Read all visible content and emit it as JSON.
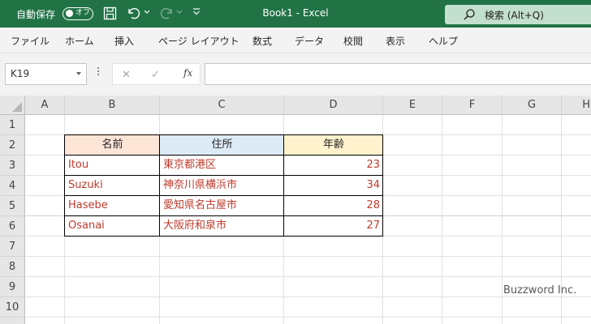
{
  "titlebar": {
    "autosave_label": "自動保存",
    "autosave_state": "オフ",
    "title": "Book1  -  Excel",
    "search_placeholder": "検索 (Alt+Q)",
    "bg_color": "#217346"
  },
  "menu": {
    "items": [
      "ファイル",
      "ホーム",
      "挿入",
      "ページ レイアウト",
      "数式",
      "データ",
      "校閲",
      "表示",
      "ヘルプ"
    ]
  },
  "formula_bar": {
    "name_box": "K19",
    "formula": ""
  },
  "sheet": {
    "columns": [
      "A",
      "B",
      "C",
      "D",
      "E",
      "F",
      "G",
      "H"
    ],
    "rows": [
      "1",
      "2",
      "3",
      "4",
      "5",
      "6",
      "7",
      "8",
      "9",
      "10"
    ],
    "table": {
      "headers": [
        "名前",
        "住所",
        "年齢"
      ],
      "header_colors": [
        "#fce4d6",
        "#ddebf7",
        "#fff2cc"
      ],
      "data_color": "#c0392b",
      "rows": [
        [
          "Itou",
          "東京都港区",
          "23"
        ],
        [
          "Suzuki",
          "神奈川県横浜市",
          "34"
        ],
        [
          "Hasebe",
          "愛知県名古屋市",
          "28"
        ],
        [
          "Osanai",
          "大阪府和泉市",
          "27"
        ]
      ]
    }
  },
  "watermark": "Buzzword Inc."
}
